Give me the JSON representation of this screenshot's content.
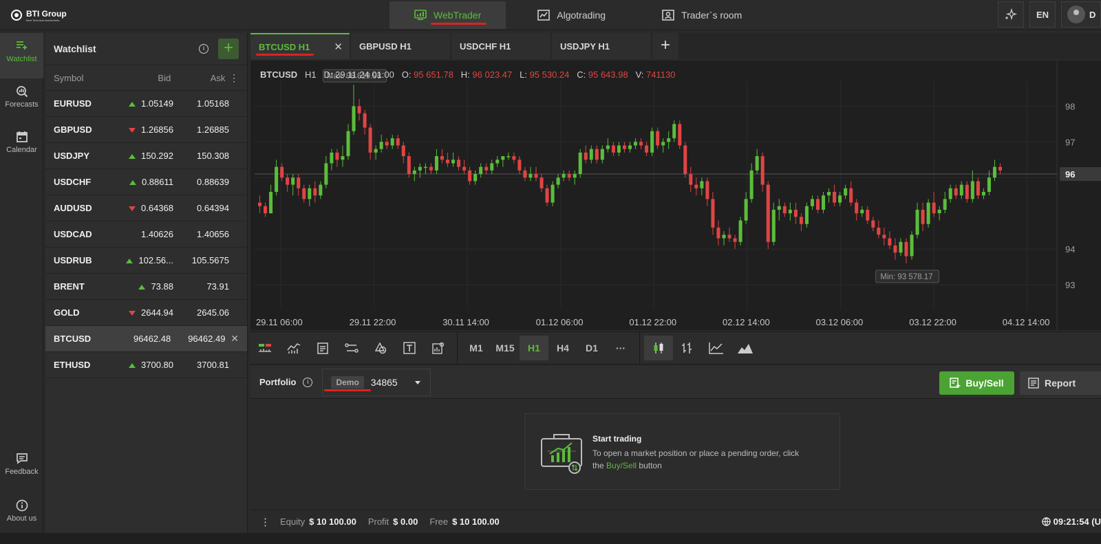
{
  "brand": {
    "name": "BTI Group",
    "tagline": "Best Technical Investments"
  },
  "top_nav": {
    "tabs": [
      {
        "label": "WebTrader",
        "active": true,
        "icon": "chart-monitor-icon"
      },
      {
        "label": "Algotrading",
        "active": false,
        "icon": "algo-icon"
      },
      {
        "label": "Trader`s room",
        "active": false,
        "icon": "user-card-icon"
      }
    ],
    "language": "EN",
    "user_initial": "D",
    "accent": "#5bbd3a"
  },
  "sidebar": {
    "items": [
      {
        "label": "Watchlist",
        "icon": "list-add-icon",
        "active": true
      },
      {
        "label": "Forecasts",
        "icon": "magnifier-chart-icon",
        "active": false
      },
      {
        "label": "Calendar",
        "icon": "calendar-icon",
        "active": false
      }
    ],
    "bottom_items": [
      {
        "label": "Feedback",
        "icon": "feedback-icon"
      },
      {
        "label": "About us",
        "icon": "info-icon"
      }
    ]
  },
  "watchlist": {
    "title": "Watchlist",
    "columns": {
      "symbol": "Symbol",
      "bid": "Bid",
      "ask": "Ask"
    },
    "rows": [
      {
        "symbol": "EURUSD",
        "dir": "up",
        "bid": "1.05149",
        "ask": "1.05168",
        "selected": false
      },
      {
        "symbol": "GBPUSD",
        "dir": "down",
        "bid": "1.26856",
        "ask": "1.26885",
        "selected": false
      },
      {
        "symbol": "USDJPY",
        "dir": "up",
        "bid": "150.292",
        "ask": "150.308",
        "selected": false
      },
      {
        "symbol": "USDCHF",
        "dir": "up",
        "bid": "0.88611",
        "ask": "0.88639",
        "selected": false
      },
      {
        "symbol": "AUDUSD",
        "dir": "down",
        "bid": "0.64368",
        "ask": "0.64394",
        "selected": false
      },
      {
        "symbol": "USDCAD",
        "dir": "",
        "bid": "1.40626",
        "ask": "1.40656",
        "selected": false
      },
      {
        "symbol": "USDRUB",
        "dir": "up",
        "bid": "102.56...",
        "ask": "105.5675",
        "selected": false
      },
      {
        "symbol": "BRENT",
        "dir": "up",
        "bid": "73.88",
        "ask": "73.91",
        "selected": false
      },
      {
        "symbol": "GOLD",
        "dir": "down",
        "bid": "2644.94",
        "ask": "2645.06",
        "selected": false
      },
      {
        "symbol": "BTCUSD",
        "dir": "",
        "bid": "96462.48",
        "ask": "96462.49",
        "selected": true
      },
      {
        "symbol": "ETHUSD",
        "dir": "up",
        "bid": "3700.80",
        "ask": "3700.81",
        "selected": false
      }
    ]
  },
  "chart_tabs": [
    {
      "label": "BTCUSD H1",
      "active": true
    },
    {
      "label": "GBPUSD H1",
      "active": false
    },
    {
      "label": "USDCHF H1",
      "active": false
    },
    {
      "label": "USDJPY H1",
      "active": false
    }
  ],
  "chart_header": {
    "symbol": "BTCUSD",
    "tf": "H1",
    "d": "D: 29.11.24 01:00",
    "o_label": "O:",
    "o": "95 651.78",
    "h_label": "H:",
    "h": "96 023.47",
    "l_label": "L:",
    "l": "95 530.24",
    "c_label": "C:",
    "c": "95 643.98",
    "v_label": "V:",
    "v": "741130"
  },
  "chart_data": {
    "type": "candlestick",
    "x_ticks": [
      "29.11 06:00",
      "29.11 22:00",
      "30.11 14:00",
      "01.12 06:00",
      "01.12 22:00",
      "02.12 14:00",
      "03.12 06:00",
      "03.12 22:00",
      "04.12 14:00"
    ],
    "y_ticks": [
      "98",
      "97",
      "96",
      "94",
      "93"
    ],
    "y_tick_values": [
      98,
      97,
      96,
      94,
      93
    ],
    "ylim": [
      92.5,
      98.7
    ],
    "current_price_label": "96",
    "current_price_value": 96.1,
    "max_label": "Max: 98 619.98",
    "min_label": "Min: 93 578.17",
    "colors": {
      "up": "#5bbd3a",
      "down": "#e04444",
      "grid": "#2a2a2a"
    },
    "ohlc": [
      [
        95.3,
        95.5,
        95.0,
        95.2
      ],
      [
        95.2,
        95.3,
        94.9,
        95.0
      ],
      [
        95.0,
        95.8,
        95.0,
        95.6
      ],
      [
        95.6,
        96.5,
        95.5,
        96.3
      ],
      [
        96.3,
        96.4,
        95.9,
        96.0
      ],
      [
        96.0,
        96.1,
        95.6,
        95.8
      ],
      [
        95.8,
        96.1,
        95.5,
        96.0
      ],
      [
        96.0,
        96.1,
        95.5,
        95.7
      ],
      [
        95.7,
        95.8,
        95.3,
        95.4
      ],
      [
        95.4,
        95.8,
        95.2,
        95.7
      ],
      [
        95.7,
        95.9,
        95.3,
        95.5
      ],
      [
        95.5,
        95.9,
        95.4,
        95.8
      ],
      [
        95.8,
        96.6,
        95.7,
        96.4
      ],
      [
        96.4,
        96.8,
        96.2,
        96.7
      ],
      [
        96.7,
        96.8,
        96.3,
        96.5
      ],
      [
        96.5,
        96.9,
        96.3,
        96.6
      ],
      [
        96.6,
        97.5,
        96.5,
        97.3
      ],
      [
        97.3,
        98.6,
        97.2,
        98.0
      ],
      [
        98.0,
        98.2,
        97.6,
        97.8
      ],
      [
        97.8,
        97.9,
        97.2,
        97.4
      ],
      [
        97.4,
        97.5,
        96.5,
        96.7
      ],
      [
        96.7,
        96.9,
        96.5,
        96.8
      ],
      [
        96.8,
        97.2,
        96.7,
        97.0
      ],
      [
        97.0,
        97.1,
        96.8,
        96.9
      ],
      [
        96.9,
        97.2,
        96.8,
        97.1
      ],
      [
        97.1,
        97.2,
        96.8,
        96.9
      ],
      [
        96.9,
        97.0,
        96.4,
        96.6
      ],
      [
        96.6,
        96.7,
        96.0,
        96.1
      ],
      [
        96.1,
        96.3,
        95.9,
        96.2
      ],
      [
        96.2,
        96.4,
        96.0,
        96.3
      ],
      [
        96.3,
        96.4,
        96.1,
        96.3
      ],
      [
        96.3,
        96.4,
        96.1,
        96.2
      ],
      [
        96.2,
        96.8,
        96.1,
        96.6
      ],
      [
        96.6,
        96.8,
        96.4,
        96.5
      ],
      [
        96.5,
        96.7,
        96.3,
        96.4
      ],
      [
        96.4,
        96.7,
        96.3,
        96.5
      ],
      [
        96.5,
        96.6,
        96.2,
        96.3
      ],
      [
        96.3,
        96.5,
        96.1,
        96.2
      ],
      [
        96.2,
        96.3,
        95.8,
        95.9
      ],
      [
        95.9,
        96.2,
        95.8,
        96.1
      ],
      [
        96.1,
        96.4,
        96.0,
        96.3
      ],
      [
        96.3,
        96.4,
        96.1,
        96.2
      ],
      [
        96.2,
        96.5,
        96.1,
        96.4
      ],
      [
        96.4,
        96.6,
        96.3,
        96.5
      ],
      [
        96.5,
        96.6,
        96.3,
        96.6
      ],
      [
        96.6,
        96.7,
        96.5,
        96.6
      ],
      [
        96.6,
        96.7,
        96.4,
        96.5
      ],
      [
        96.5,
        96.6,
        96.1,
        96.2
      ],
      [
        96.2,
        96.3,
        95.9,
        96.0
      ],
      [
        96.0,
        96.3,
        95.9,
        96.1
      ],
      [
        96.1,
        96.3,
        95.9,
        96.0
      ],
      [
        96.0,
        96.1,
        95.6,
        95.7
      ],
      [
        95.7,
        95.8,
        95.2,
        95.3
      ],
      [
        95.3,
        95.9,
        95.2,
        95.8
      ],
      [
        95.8,
        96.1,
        95.7,
        96.0
      ],
      [
        96.0,
        96.2,
        95.9,
        96.1
      ],
      [
        96.1,
        96.2,
        95.9,
        96.0
      ],
      [
        96.0,
        96.2,
        95.8,
        96.1
      ],
      [
        96.1,
        96.8,
        96.0,
        96.7
      ],
      [
        96.7,
        96.9,
        96.4,
        96.5
      ],
      [
        96.5,
        96.9,
        96.4,
        96.8
      ],
      [
        96.8,
        96.9,
        96.4,
        96.5
      ],
      [
        96.5,
        96.9,
        96.4,
        96.8
      ],
      [
        96.8,
        97.1,
        96.7,
        96.9
      ],
      [
        96.9,
        97.0,
        96.6,
        96.7
      ],
      [
        96.7,
        97.0,
        96.6,
        96.9
      ],
      [
        96.9,
        97.0,
        96.7,
        96.8
      ],
      [
        96.8,
        97.0,
        96.7,
        96.9
      ],
      [
        96.9,
        97.1,
        96.8,
        97.0
      ],
      [
        97.0,
        97.1,
        96.8,
        96.9
      ],
      [
        96.9,
        97.0,
        96.6,
        96.7
      ],
      [
        96.7,
        97.4,
        96.6,
        97.3
      ],
      [
        97.3,
        97.4,
        96.8,
        96.9
      ],
      [
        96.9,
        97.1,
        96.7,
        97.0
      ],
      [
        97.0,
        97.3,
        96.8,
        97.1
      ],
      [
        97.1,
        97.6,
        97.0,
        97.5
      ],
      [
        97.5,
        97.6,
        96.8,
        96.9
      ],
      [
        96.9,
        97.0,
        96.0,
        96.1
      ],
      [
        96.1,
        96.3,
        95.6,
        95.8
      ],
      [
        95.8,
        96.0,
        95.5,
        95.7
      ],
      [
        95.7,
        96.0,
        95.5,
        95.9
      ],
      [
        95.9,
        96.0,
        95.2,
        95.4
      ],
      [
        95.4,
        95.6,
        94.4,
        94.6
      ],
      [
        94.6,
        94.8,
        94.1,
        94.3
      ],
      [
        94.3,
        94.5,
        94.1,
        94.4
      ],
      [
        94.4,
        94.6,
        94.2,
        94.3
      ],
      [
        94.3,
        94.4,
        94.0,
        94.2
      ],
      [
        94.2,
        94.9,
        94.1,
        94.8
      ],
      [
        94.8,
        95.6,
        94.7,
        95.4
      ],
      [
        95.4,
        96.4,
        95.3,
        96.2
      ],
      [
        96.2,
        96.8,
        96.1,
        96.6
      ],
      [
        96.6,
        96.7,
        95.6,
        95.8
      ],
      [
        95.8,
        95.9,
        94.0,
        94.2
      ],
      [
        94.2,
        95.3,
        94.1,
        95.1
      ],
      [
        95.1,
        95.4,
        94.8,
        95.2
      ],
      [
        95.2,
        95.3,
        94.9,
        95.0
      ],
      [
        95.0,
        95.3,
        94.8,
        95.1
      ],
      [
        95.1,
        95.3,
        94.7,
        94.9
      ],
      [
        94.9,
        95.0,
        94.5,
        94.7
      ],
      [
        94.7,
        95.3,
        94.6,
        95.2
      ],
      [
        95.2,
        95.5,
        95.1,
        95.4
      ],
      [
        95.4,
        95.5,
        95.0,
        95.1
      ],
      [
        95.1,
        95.6,
        95.0,
        95.5
      ],
      [
        95.5,
        95.7,
        95.3,
        95.6
      ],
      [
        95.6,
        95.8,
        95.2,
        95.3
      ],
      [
        95.3,
        95.6,
        95.2,
        95.5
      ],
      [
        95.5,
        95.8,
        95.4,
        95.7
      ],
      [
        95.7,
        95.9,
        95.2,
        95.3
      ],
      [
        95.3,
        95.4,
        94.8,
        95.0
      ],
      [
        95.0,
        95.2,
        94.9,
        95.1
      ],
      [
        95.1,
        95.2,
        94.7,
        94.8
      ],
      [
        94.8,
        94.9,
        94.5,
        94.6
      ],
      [
        94.6,
        94.8,
        94.3,
        94.4
      ],
      [
        94.4,
        94.6,
        94.1,
        94.3
      ],
      [
        94.3,
        94.5,
        94.0,
        94.1
      ],
      [
        94.1,
        94.3,
        93.7,
        93.9
      ],
      [
        93.9,
        94.3,
        93.8,
        94.2
      ],
      [
        94.2,
        94.3,
        93.6,
        93.8
      ],
      [
        93.8,
        94.5,
        93.7,
        94.4
      ],
      [
        94.4,
        95.3,
        94.3,
        95.1
      ],
      [
        95.1,
        95.3,
        94.5,
        94.7
      ],
      [
        94.7,
        95.4,
        94.6,
        95.3
      ],
      [
        95.3,
        95.6,
        94.9,
        95.0
      ],
      [
        95.0,
        95.2,
        94.8,
        95.1
      ],
      [
        95.1,
        95.6,
        95.0,
        95.4
      ],
      [
        95.4,
        95.8,
        95.3,
        95.7
      ],
      [
        95.7,
        95.8,
        95.4,
        95.5
      ],
      [
        95.5,
        95.9,
        95.4,
        95.8
      ],
      [
        95.8,
        95.9,
        95.3,
        95.4
      ],
      [
        95.4,
        96.2,
        95.3,
        95.9
      ],
      [
        95.9,
        96.0,
        95.4,
        95.5
      ],
      [
        95.5,
        95.7,
        95.4,
        95.6
      ],
      [
        95.6,
        96.2,
        95.5,
        96.0
      ],
      [
        96.0,
        96.5,
        95.9,
        96.3
      ],
      [
        96.3,
        96.4,
        96.1,
        96.2
      ]
    ]
  },
  "toolbar": {
    "timeframes": [
      {
        "label": "M1",
        "active": false
      },
      {
        "label": "M15",
        "active": false
      },
      {
        "label": "H1",
        "active": true
      },
      {
        "label": "H4",
        "active": false
      },
      {
        "label": "D1",
        "active": false
      }
    ],
    "more": "···"
  },
  "portfolio": {
    "title": "Portfolio",
    "account_type": "Demo",
    "account_number": "34865",
    "buy_sell": "Buy/Sell",
    "report": "Report",
    "empty_title": "Start trading",
    "empty_desc_1": "To open a market position or place a pending order, click",
    "empty_desc_the": "the",
    "empty_desc_link": "Buy/Sell",
    "empty_desc_2": "button"
  },
  "status": {
    "equity_label": "Equity",
    "equity": "$ 10 100.00",
    "profit_label": "Profit",
    "profit": "$ 0.00",
    "free_label": "Free",
    "free": "$ 10 100.00",
    "clock": "09:21:54 (U"
  }
}
